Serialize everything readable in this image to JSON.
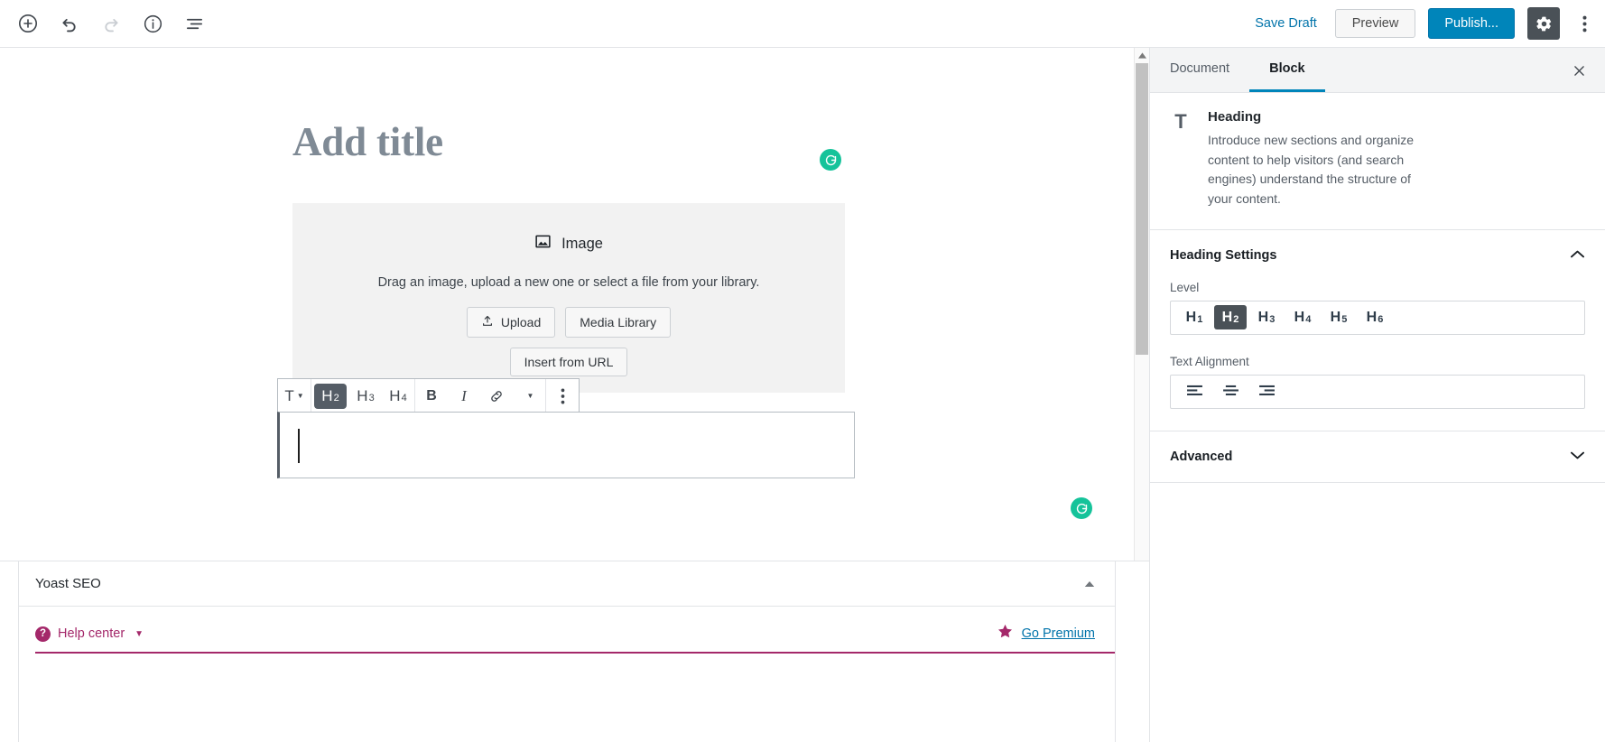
{
  "topbar": {
    "icons": [
      {
        "name": "add-block-icon",
        "label": "Add block"
      },
      {
        "name": "undo-icon",
        "label": "Undo"
      },
      {
        "name": "redo-icon",
        "label": "Redo"
      },
      {
        "name": "info-icon",
        "label": "Content structure"
      },
      {
        "name": "block-navigation-icon",
        "label": "Block navigation"
      }
    ],
    "save_draft_label": "Save Draft",
    "preview_label": "Preview",
    "publish_label": "Publish...",
    "settings_icon": "gear-icon",
    "more_icon": "more-vertical-icon"
  },
  "editor": {
    "title_placeholder": "Add title",
    "image_block": {
      "icon_name": "image-icon",
      "label": "Image",
      "description": "Drag an image, upload a new one or select a file from your library.",
      "upload_label": "Upload",
      "media_library_label": "Media Library",
      "insert_from_url_label": "Insert from URL"
    },
    "block_toolbar": {
      "type_label": "T",
      "levels": [
        "H2",
        "H3",
        "H4"
      ],
      "active_level": "H2",
      "bold_label": "B",
      "italic_label": "I",
      "link_icon": "link-icon",
      "more_rich_text_icon": "chevron-down-icon",
      "more_options_icon": "more-vertical-icon"
    },
    "grammarly_badge": "G"
  },
  "sidebar": {
    "tabs": [
      {
        "label": "Document",
        "active": false
      },
      {
        "label": "Block",
        "active": true
      }
    ],
    "close_icon": "close-icon",
    "block_card": {
      "icon": "T",
      "title": "Heading",
      "description": "Introduce new sections and organize content to help visitors (and search engines) understand the structure of your content."
    },
    "panels": [
      {
        "title": "Heading Settings",
        "expanded": true,
        "chevron": "chevron-up-icon",
        "level_label": "Level",
        "levels": [
          "H1",
          "H2",
          "H3",
          "H4",
          "H5",
          "H6"
        ],
        "active_level": "H2",
        "alignment_label": "Text Alignment",
        "alignments": [
          "align-left-icon",
          "align-center-icon",
          "align-right-icon"
        ]
      },
      {
        "title": "Advanced",
        "expanded": false,
        "chevron": "chevron-down-icon"
      }
    ]
  },
  "yoast": {
    "title": "Yoast SEO",
    "collapse_icon": "caret-up-icon",
    "help_center_label": "Help center",
    "help_icon": "?",
    "go_premium_label": "Go Premium",
    "star_icon": "star-icon"
  },
  "colors": {
    "accent_blue": "#0085ba",
    "link_blue": "#0073aa",
    "dark_gray": "#4a5157",
    "yoast_purple": "#a4286a",
    "grammarly_green": "#15c39a"
  }
}
